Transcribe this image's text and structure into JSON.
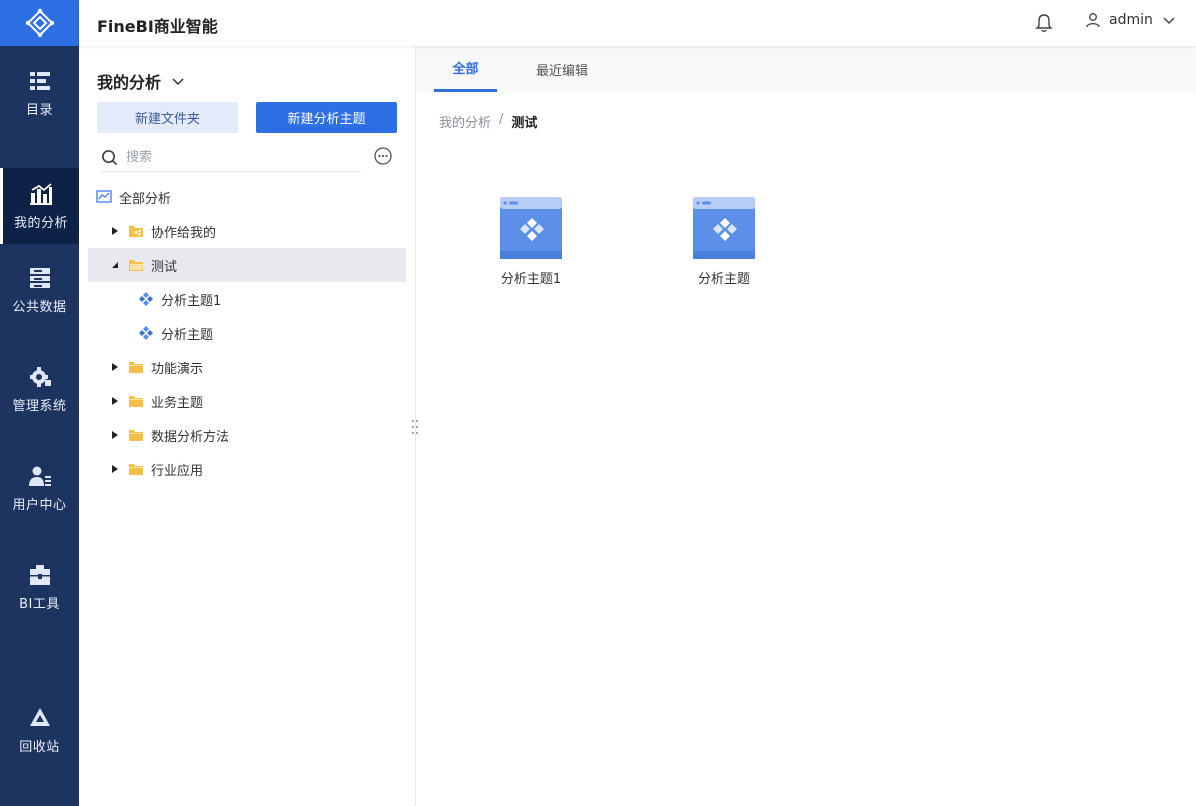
{
  "app": {
    "title": "FineBI商业智能"
  },
  "rail": {
    "items": [
      {
        "label": "目录",
        "icon": "catalog-icon"
      },
      {
        "label": "我的分析",
        "icon": "analysis-chart-icon"
      },
      {
        "label": "公共数据",
        "icon": "database-icon"
      },
      {
        "label": "管理系统",
        "icon": "gear-icon"
      },
      {
        "label": "用户中心",
        "icon": "user-manage-icon"
      },
      {
        "label": "BI工具",
        "icon": "toolbox-icon"
      },
      {
        "label": "回收站",
        "icon": "recycle-icon"
      }
    ],
    "active": "我的分析"
  },
  "header": {
    "user": "admin"
  },
  "panel": {
    "title": "我的分析",
    "new_folder": "新建文件夹",
    "new_subject": "新建分析主题",
    "search_placeholder": "搜索",
    "tree": [
      {
        "label": "全部分析"
      },
      {
        "label": "协作给我的"
      },
      {
        "label": "测试"
      },
      {
        "label": "分析主题1"
      },
      {
        "label": "分析主题"
      },
      {
        "label": "功能演示"
      },
      {
        "label": "业务主题"
      },
      {
        "label": "数据分析方法"
      },
      {
        "label": "行业应用"
      }
    ]
  },
  "tabs": [
    {
      "label": "全部"
    },
    {
      "label": "最近编辑"
    }
  ],
  "breadcrumb": {
    "root": "我的分析",
    "sep": "/",
    "current": "测试"
  },
  "cards": [
    {
      "label": "分析主题1"
    },
    {
      "label": "分析主题"
    }
  ],
  "colors": {
    "accent": "#2f6fe4",
    "rail": "#1e3460",
    "folder": "#f5c04a"
  }
}
